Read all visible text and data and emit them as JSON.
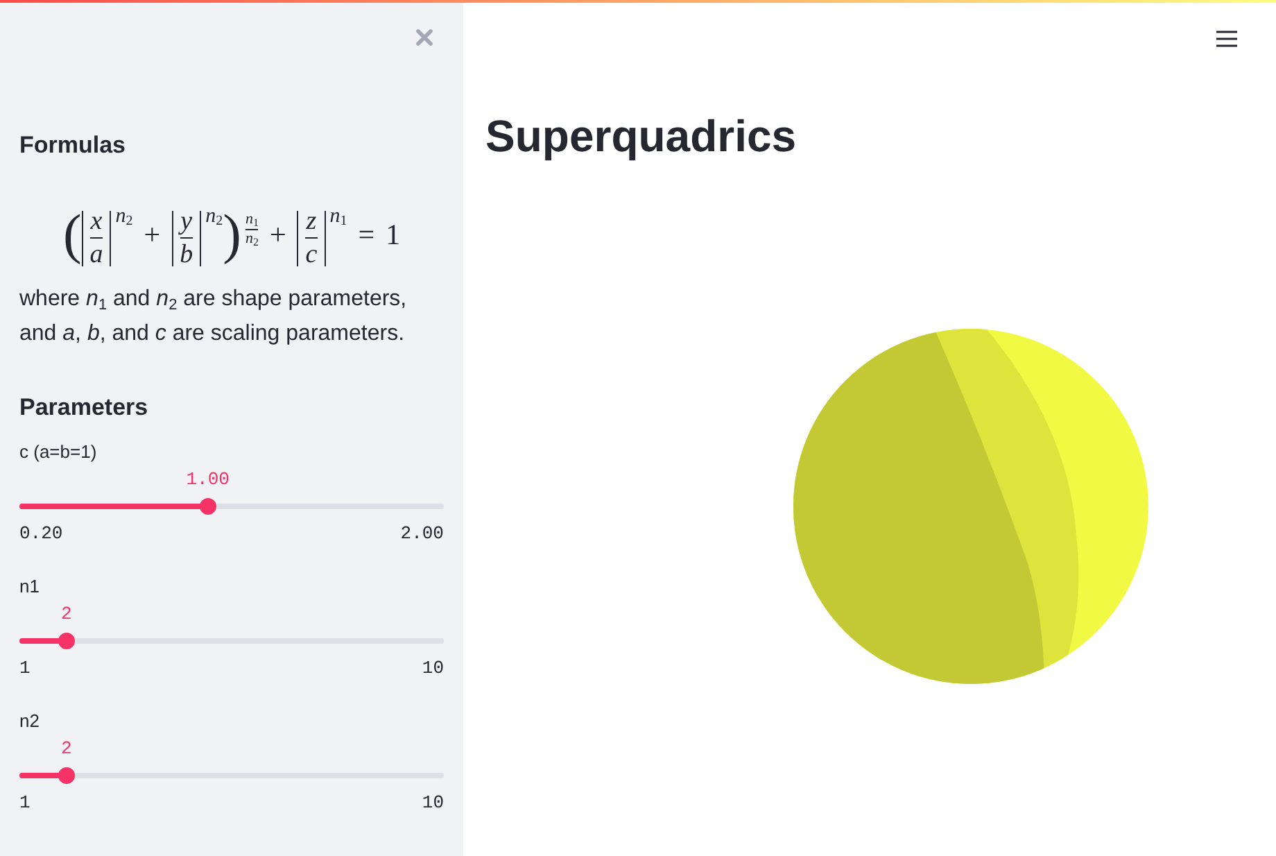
{
  "sidebar": {
    "formulas_heading": "Formulas",
    "formula": [
      {
        "kind": "paren",
        "text": "("
      },
      {
        "kind": "abs_frac",
        "num": "x",
        "den": "a",
        "exp": "*n*$_{2}$"
      },
      {
        "kind": "op",
        "text": "+"
      },
      {
        "kind": "abs_frac",
        "num": "y",
        "den": "b",
        "exp": "*n*$_{2}$"
      },
      {
        "kind": "paren_frac_exp",
        "text": ")",
        "exp_num": "*n*$_{1}$",
        "exp_den": "*n*$_{2}$"
      },
      {
        "kind": "op",
        "text": "+"
      },
      {
        "kind": "abs_frac",
        "num": "z",
        "den": "c",
        "exp": "*n*$_{1}$"
      },
      {
        "kind": "op",
        "text": "="
      },
      {
        "kind": "number",
        "text": "1"
      }
    ],
    "description": "where *n*$_{1}$ and *n*$_{2}$ are shape parameters, and *a*, *b*, and *c* are scaling parameters.",
    "parameters_heading": "Parameters",
    "sliders": [
      {
        "label": "c (a=b=1)",
        "value": "1.00",
        "level": 0.444,
        "min": "0.20",
        "max": "2.00"
      },
      {
        "label": "n1",
        "value": "2",
        "level": 0.111,
        "min": "1",
        "max": "10"
      },
      {
        "label": "n2",
        "value": "2",
        "level": 0.111,
        "min": "1",
        "max": "10"
      }
    ]
  },
  "main": {
    "title": "Superquadrics"
  }
}
